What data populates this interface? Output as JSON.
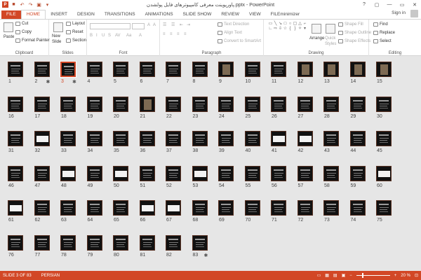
{
  "titlebar": {
    "title": "پاورپوینت معرفی کامپیوترهای فایل پولشدن.pptx - PowerPoint",
    "app_logo": "P",
    "qat": [
      "save-icon",
      "undo-icon",
      "redo-icon",
      "start-slideshow-icon",
      "customize-icon"
    ],
    "window_controls": [
      "?",
      "▢",
      "—",
      "▭",
      "✕"
    ]
  },
  "tabs": [
    "FILE",
    "HOME",
    "INSERT",
    "DESIGN",
    "TRANSITIONS",
    "ANIMATIONS",
    "SLIDE SHOW",
    "REVIEW",
    "VIEW",
    "FILEminimizer"
  ],
  "active_tab": "HOME",
  "account": {
    "sign_in": "Sign in"
  },
  "ribbon": {
    "clipboard": {
      "label": "Clipboard",
      "paste": "Paste",
      "cut": "Cut",
      "copy": "Copy",
      "format_painter": "Format Painter"
    },
    "slides": {
      "label": "Slides",
      "new_slide": "New",
      "new_slide2": "Slide",
      "layout": "Layout",
      "reset": "Reset",
      "section": "Section"
    },
    "font": {
      "label": "Font"
    },
    "paragraph": {
      "label": "Paragraph",
      "text_direction": "Text Direction",
      "align_text": "Align Text",
      "convert_smartart": "Convert to SmartArt"
    },
    "drawing": {
      "label": "Drawing",
      "arrange": "Arrange",
      "quick_styles": "Quick",
      "quick_styles2": "Styles",
      "shape_fill": "Shape Fill",
      "shape_outline": "Shape Outline",
      "shape_effects": "Shape Effects"
    },
    "editing": {
      "label": "Editing",
      "find": "Find",
      "replace": "Replace",
      "select": "Select"
    }
  },
  "slides": {
    "count": 83,
    "selected": 3,
    "starred": [
      2,
      3,
      83
    ],
    "white_content": [
      32,
      41,
      42,
      48,
      50,
      53,
      60,
      61,
      66,
      67
    ],
    "photo_content": [
      9,
      12,
      13,
      14,
      15,
      21
    ]
  },
  "status": {
    "slide_position": "SLIDE 3 OF 83",
    "language": "PERSIAN",
    "zoom": "20 %"
  }
}
